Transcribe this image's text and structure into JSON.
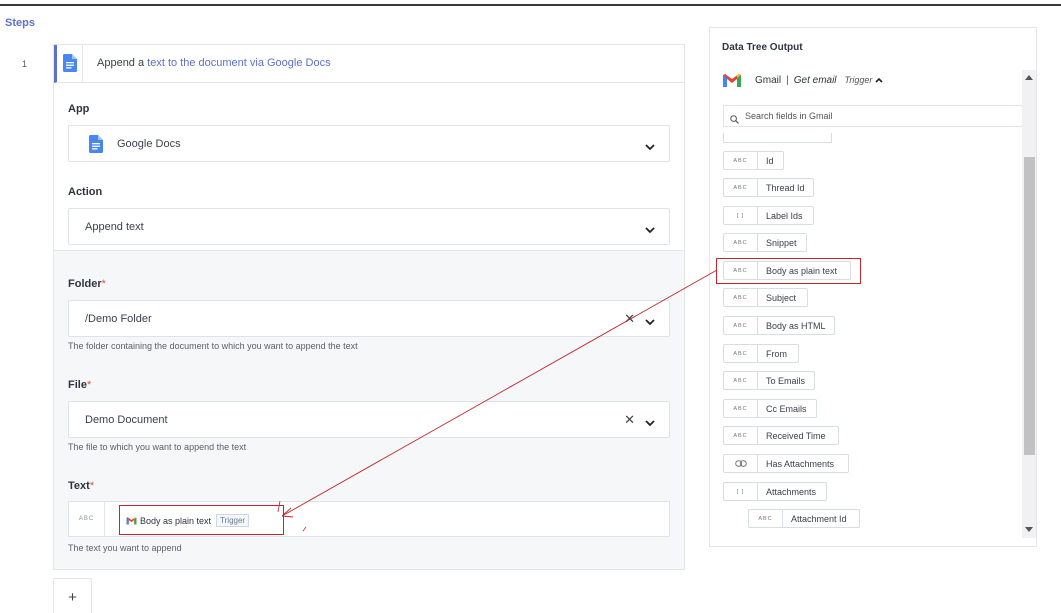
{
  "steps": {
    "title": "Steps",
    "step_number": "1",
    "step_title_prefix": "Append a ",
    "step_title_link": "text to the document via Google Docs"
  },
  "app": {
    "label": "App",
    "value": "Google Docs"
  },
  "action": {
    "label": "Action",
    "value": "Append text"
  },
  "folder": {
    "label": "Folder",
    "required_mark": "*",
    "value": "/Demo Folder",
    "hint": "The folder containing the document to which you want to append the text"
  },
  "file": {
    "label": "File",
    "required_mark": "*",
    "value": "Demo Document",
    "hint": "The file to which you want to append the text"
  },
  "text": {
    "label": "Text",
    "required_mark": "*",
    "type_badge": "ABC",
    "token_label": "Body as plain text",
    "token_trigger": "Trigger",
    "hint": "The text you want to append"
  },
  "add_step": {
    "label": "+"
  },
  "data_tree": {
    "title": "Data Tree Output",
    "app_name": "Gmail",
    "separator": "|",
    "event": "Get email",
    "trigger": "Trigger",
    "search_placeholder": "Search fields in Gmail",
    "fields": [
      {
        "type": "ABC",
        "name": "Id"
      },
      {
        "type": "ABC",
        "name": "Thread Id"
      },
      {
        "type": "[ ]",
        "name": "Label Ids"
      },
      {
        "type": "ABC",
        "name": "Snippet"
      },
      {
        "type": "ABC",
        "name": "Body as plain text"
      },
      {
        "type": "ABC",
        "name": "Subject"
      },
      {
        "type": "ABC",
        "name": "Body as HTML"
      },
      {
        "type": "ABC",
        "name": "From"
      },
      {
        "type": "ABC",
        "name": "To Emails"
      },
      {
        "type": "ABC",
        "name": "Cc Emails"
      },
      {
        "type": "ABC",
        "name": "Received Time"
      },
      {
        "type": "link",
        "name": "Has Attachments"
      },
      {
        "type": "[ ]",
        "name": "Attachments"
      },
      {
        "type": "ABC",
        "name": "Attachment Id"
      }
    ]
  },
  "colors": {
    "accent": "#5b72c8",
    "highlight": "#c0272d",
    "required": "#d9534f"
  }
}
